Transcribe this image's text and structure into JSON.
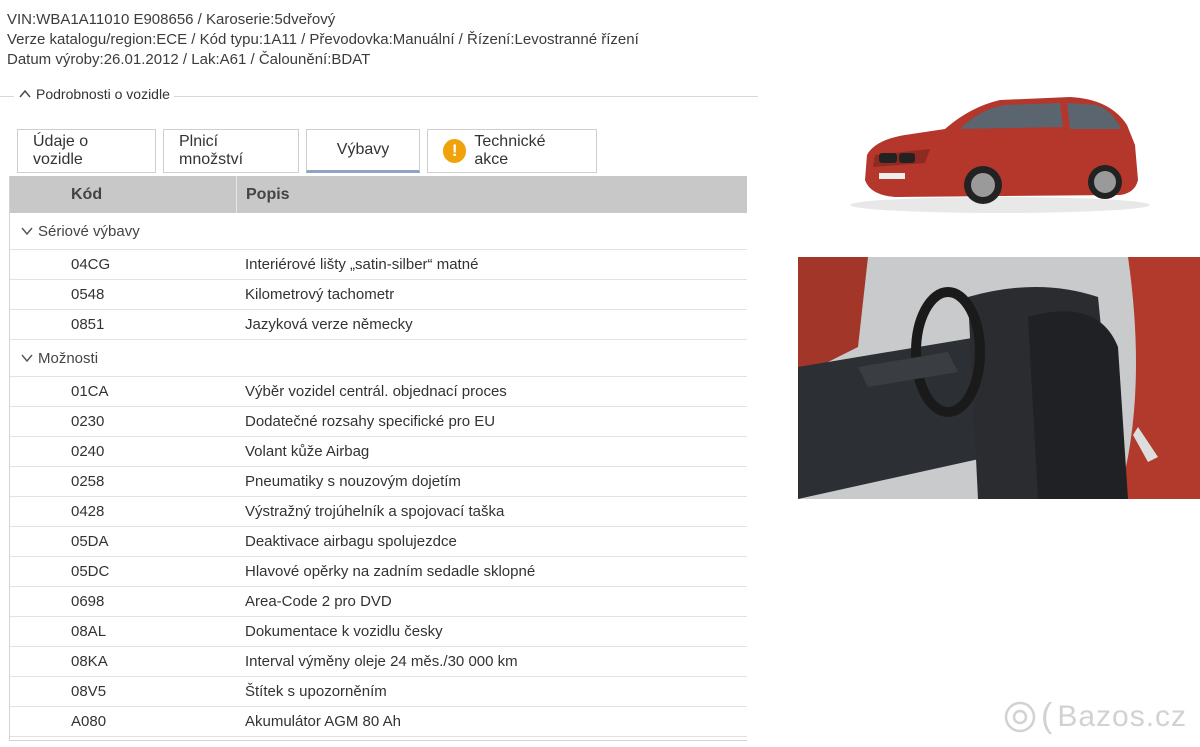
{
  "header": {
    "line1": "VIN:WBA1A11010 E908656 / Karoserie:5dveřový",
    "line2": "Verze katalogu/region:ECE / Kód typu:1A11 / Převodovka:Manuální / Řízení:Levostranné řízení",
    "line3": "Datum výroby:26.01.2012 / Lak:A61 / Čalounění:BDAT"
  },
  "section": {
    "title": "Podrobnosti o vozidle"
  },
  "tabs": [
    {
      "label": "Údaje o vozidle"
    },
    {
      "label": "Plnicí množství"
    },
    {
      "label": "Výbavy"
    },
    {
      "label": "Technické akce"
    }
  ],
  "table": {
    "col_code": "Kód",
    "col_desc": "Popis",
    "groups": [
      {
        "title": "Sériové výbavy",
        "rows": [
          {
            "code": "04CG",
            "desc": "Interiérové lišty „satin-silber“ matné"
          },
          {
            "code": "0548",
            "desc": "Kilometrový tachometr"
          },
          {
            "code": "0851",
            "desc": "Jazyková verze německy"
          }
        ]
      },
      {
        "title": "Možnosti",
        "rows": [
          {
            "code": "01CA",
            "desc": "Výběr vozidel centrál. objednací proces"
          },
          {
            "code": "0230",
            "desc": "Dodatečné rozsahy specifické pro EU"
          },
          {
            "code": "0240",
            "desc": "Volant kůže Airbag"
          },
          {
            "code": "0258",
            "desc": "Pneumatiky s nouzovým dojetím"
          },
          {
            "code": "0428",
            "desc": "Výstražný trojúhelník a spojovací taška"
          },
          {
            "code": "05DA",
            "desc": "Deaktivace airbagu spolujezdce"
          },
          {
            "code": "05DC",
            "desc": "Hlavové opěrky na zadním sedadle sklopné"
          },
          {
            "code": "0698",
            "desc": "Area-Code 2 pro DVD"
          },
          {
            "code": "08AL",
            "desc": "Dokumentace k vozidlu česky"
          },
          {
            "code": "08KA",
            "desc": "Interval výměny oleje 24 měs./30 000 km"
          },
          {
            "code": "08V5",
            "desc": "Štítek s upozorněním"
          },
          {
            "code": "A080",
            "desc": "Akumulátor AGM 80 Ah"
          }
        ]
      }
    ]
  },
  "watermark": {
    "text": "Bazos.cz"
  },
  "colors": {
    "car_red": "#b5362a",
    "warning": "#f0a20a",
    "header_bg": "#c8c8c8",
    "tab_active_underline": "#8fa4c2"
  }
}
